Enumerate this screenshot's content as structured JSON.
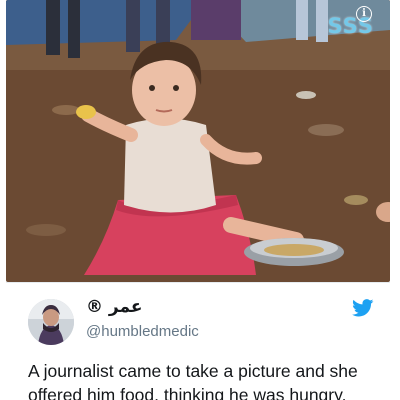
{
  "photo": {
    "watermark": "SSS",
    "info_icon": "i"
  },
  "tweet": {
    "display_name": "عمر ®",
    "handle": "@humbledmedic",
    "text": "A journalist came to take a picture and she offered him food, thinking he was hungry.",
    "brand_icon": "twitter-bird-icon",
    "accent_color": "#1da1f2"
  }
}
